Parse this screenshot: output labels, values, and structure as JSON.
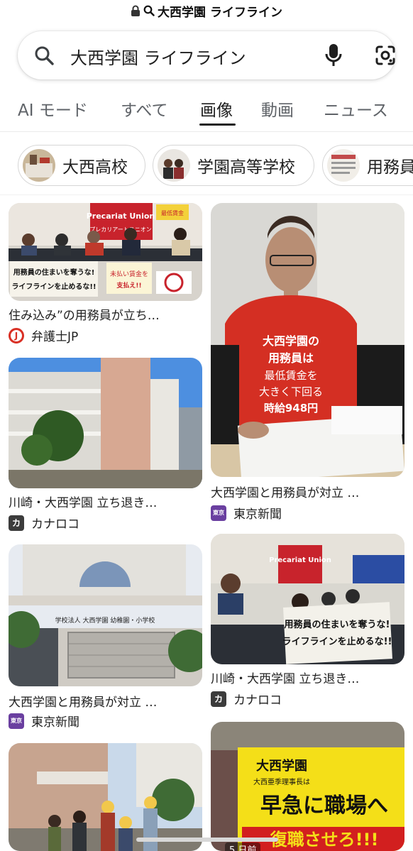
{
  "browser": {
    "url_text": "大西学園 ライフライン",
    "lock_icon": "lock-icon",
    "search_icon": "search-icon"
  },
  "search": {
    "query": "大西学園 ライフライン",
    "icons": [
      "search-icon",
      "mic-icon",
      "camera-lens-icon"
    ]
  },
  "tabs": [
    {
      "label": "AI モード",
      "active": false
    },
    {
      "label": "すべて",
      "active": false
    },
    {
      "label": "画像",
      "active": true
    },
    {
      "label": "動画",
      "active": false
    },
    {
      "label": "ニュース",
      "active": false
    }
  ],
  "chips": [
    {
      "label": "大西高校"
    },
    {
      "label": "学園高等学校"
    },
    {
      "label": "用務員"
    }
  ],
  "results": [
    {
      "caption": "住み込み”の用務員が立ち…",
      "source": "弁護士JP",
      "favicon_text": "J",
      "favicon_color": "#d93025",
      "image_text": {
        "banner_top": "Precariat Union",
        "banner_sub": "プレカリアートユニオン",
        "sign_left": "最低賃金",
        "sign_main_1": "用務員の住まいを奪うな!",
        "sign_main_2": "ライフラインを止めるな!!",
        "sign_small_1": "未払い賃金を",
        "sign_small_2": "支払え!!"
      }
    },
    {
      "caption": "大西学園と用務員が対立 …",
      "source": "東京新聞",
      "favicon_text": "東京",
      "favicon_color": "#6a3fa0",
      "image_text": {
        "shirt_1": "大西学園の",
        "shirt_2": "用務員は",
        "shirt_3": "最低賃金を",
        "shirt_4": "大きく下回る",
        "shirt_5": "時給948円"
      }
    },
    {
      "caption": "川崎・大西学園 立ち退き…",
      "source": "カナロコ",
      "favicon_text": "カ",
      "favicon_color": "#3c3c3c",
      "image_text": {}
    },
    {
      "caption": "川崎・大西学園 立ち退き…",
      "source": "カナロコ",
      "favicon_text": "カ",
      "favicon_color": "#3c3c3c",
      "image_text": {
        "banner": "Precariat Union",
        "sign_main_1": "用務員の住まいを奪うな!",
        "sign_main_2": "ライフラインを止めるな!!"
      }
    },
    {
      "caption": "大西学園と用務員が対立 …",
      "source": "東京新聞",
      "favicon_text": "東京",
      "favicon_color": "#6a3fa0",
      "image_text": {
        "school_name": "学校法人 大西学園 幼稚園・小学校"
      }
    },
    {
      "caption": "",
      "source": "",
      "image_text": {}
    },
    {
      "caption": "",
      "source": "",
      "image_text": {
        "title": "大西学園",
        "subtitle": "大西亜季理事長は",
        "main": "早急に職場へ",
        "bottom": "復職させろ!!!",
        "timestamp": "5 日前"
      }
    }
  ]
}
